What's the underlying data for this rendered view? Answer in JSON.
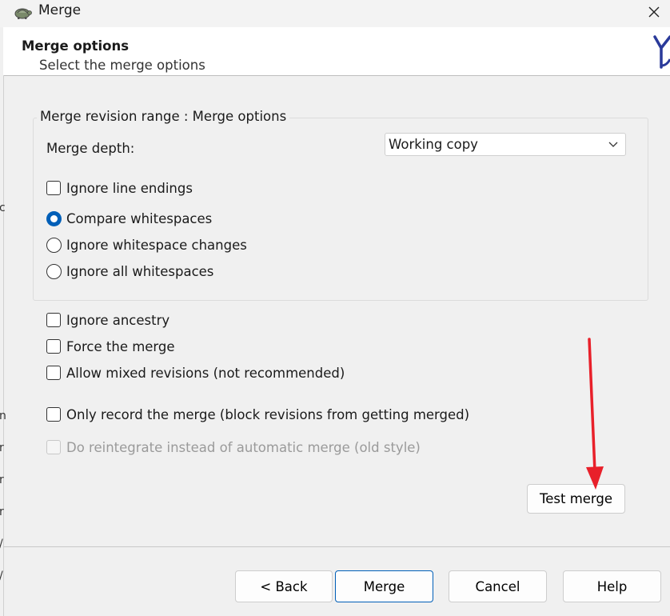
{
  "window": {
    "title": "Merge",
    "app_icon": "tortoise-icon",
    "close_icon": "close-icon"
  },
  "header": {
    "title": "Merge options",
    "subtitle": "Select the merge options",
    "logo": "tortoisesvn-logo-icon"
  },
  "group": {
    "legend": "Merge revision range : Merge options",
    "merge_depth_label": "Merge depth:",
    "merge_depth_value": "Working copy",
    "ignore_line_endings": {
      "label": "Ignore line endings",
      "checked": false
    },
    "whitespace": [
      {
        "label": "Compare whitespaces",
        "checked": true
      },
      {
        "label": "Ignore whitespace changes",
        "checked": false
      },
      {
        "label": "Ignore all whitespaces",
        "checked": false
      }
    ]
  },
  "options": [
    {
      "label": "Ignore ancestry",
      "checked": false
    },
    {
      "label": "Force the merge",
      "checked": false
    },
    {
      "label": "Allow mixed revisions (not recommended)",
      "checked": false
    },
    {
      "label": "Only record the merge (block revisions from getting merged)",
      "checked": false
    },
    {
      "label": "Do reintegrate instead of automatic merge (old style)",
      "checked": false,
      "disabled": true
    }
  ],
  "test_merge_label": "Test merge",
  "footer": {
    "back_label": "< Back",
    "merge_label": "Merge",
    "cancel_label": "Cancel",
    "help_label": "Help"
  },
  "accent_color": "#005fb8",
  "annotation_arrow_color": "#e8202a"
}
